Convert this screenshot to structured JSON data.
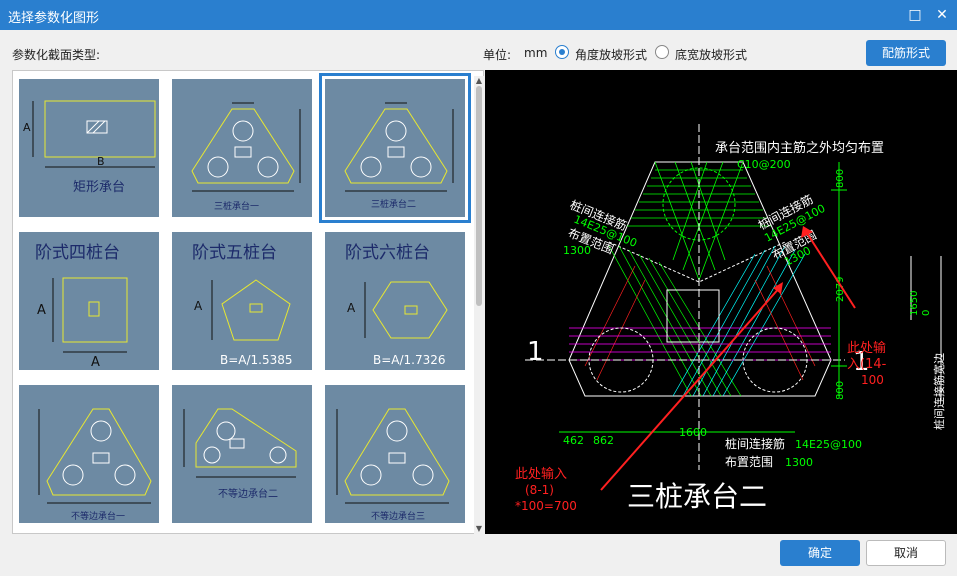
{
  "window": {
    "title": "选择参数化图形",
    "maximize_glyph": "□",
    "close_glyph": "✕"
  },
  "left_label": "参数化截面类型:",
  "unit": {
    "label": "单位:",
    "value": "mm",
    "options": [
      {
        "label": "角度放坡形式",
        "checked": true
      },
      {
        "label": "底宽放坡形式",
        "checked": false
      }
    ]
  },
  "rebar_button": "配筋形式",
  "tiles": [
    {
      "name": "rectangular-cap",
      "caption": "矩形承台",
      "dims": {
        "a": "A",
        "b": "B"
      }
    },
    {
      "name": "three-pile-cap-1",
      "caption": "三桩承台一"
    },
    {
      "name": "three-pile-cap-2",
      "caption": "三桩承台二",
      "selected": true
    },
    {
      "name": "stepped-four-pile",
      "title": "阶式四桩台",
      "dims": {
        "a": "A",
        "b": "A"
      }
    },
    {
      "name": "stepped-five-pile",
      "title": "阶式五桩台",
      "formula": "B=A/1.5385",
      "dims": {
        "a": "A"
      }
    },
    {
      "name": "stepped-six-pile",
      "title": "阶式六桩台",
      "formula": "B=A/1.7326",
      "dims": {
        "a": "A"
      }
    },
    {
      "name": "unequal-cap-1",
      "caption": "不等边承台一"
    },
    {
      "name": "unequal-cap-2",
      "caption": "不等边承台二"
    },
    {
      "name": "unequal-cap-3",
      "caption": "不等边承台三"
    }
  ],
  "preview": {
    "note_main": "承台范围内主筋之外均匀布置",
    "note_main_spec": "C10@200",
    "left_rebar_label": "桩间连接筋",
    "left_rebar_spec": "14E25@100",
    "left_range_label": "布置范围",
    "left_range_value": "1300",
    "right_rebar_label": "桩间连接筋",
    "right_rebar_spec": "14E25@100",
    "right_range_label": "布置范围",
    "right_range_value": "1300",
    "bottom_rebar_label": "桩间连接筋",
    "bottom_rebar_spec": "14E25@100",
    "bottom_range_label": "布置范围",
    "bottom_range_value": "1300",
    "dim_top": "800",
    "dim_mid": "2079",
    "dim_bottom": "800",
    "dim_1650": "1650",
    "dim_0": "0",
    "dim_462": "462",
    "dim_862": "862",
    "dim_1600": "1600",
    "section_left": "1",
    "section_right": "1",
    "red_note_right_1": "此处输",
    "red_note_right_2": "入(14-",
    "red_note_right_3": "100",
    "red_note_bottom_1": "此处输入",
    "red_note_bottom_2": "(8-1)",
    "red_note_bottom_3": "*100=700",
    "side_text": "桩间连接筋宽边",
    "big_title": "三桩承台二"
  },
  "ok_button": "确定",
  "cancel_button": "取消",
  "colors": {
    "accent": "#2a7fcf",
    "tile_bg": "#6d8aa3",
    "cad_green": "#00ff00",
    "cad_red": "#ff2020",
    "cad_magenta": "#ff00ff",
    "cad_cyan": "#00ffff"
  }
}
